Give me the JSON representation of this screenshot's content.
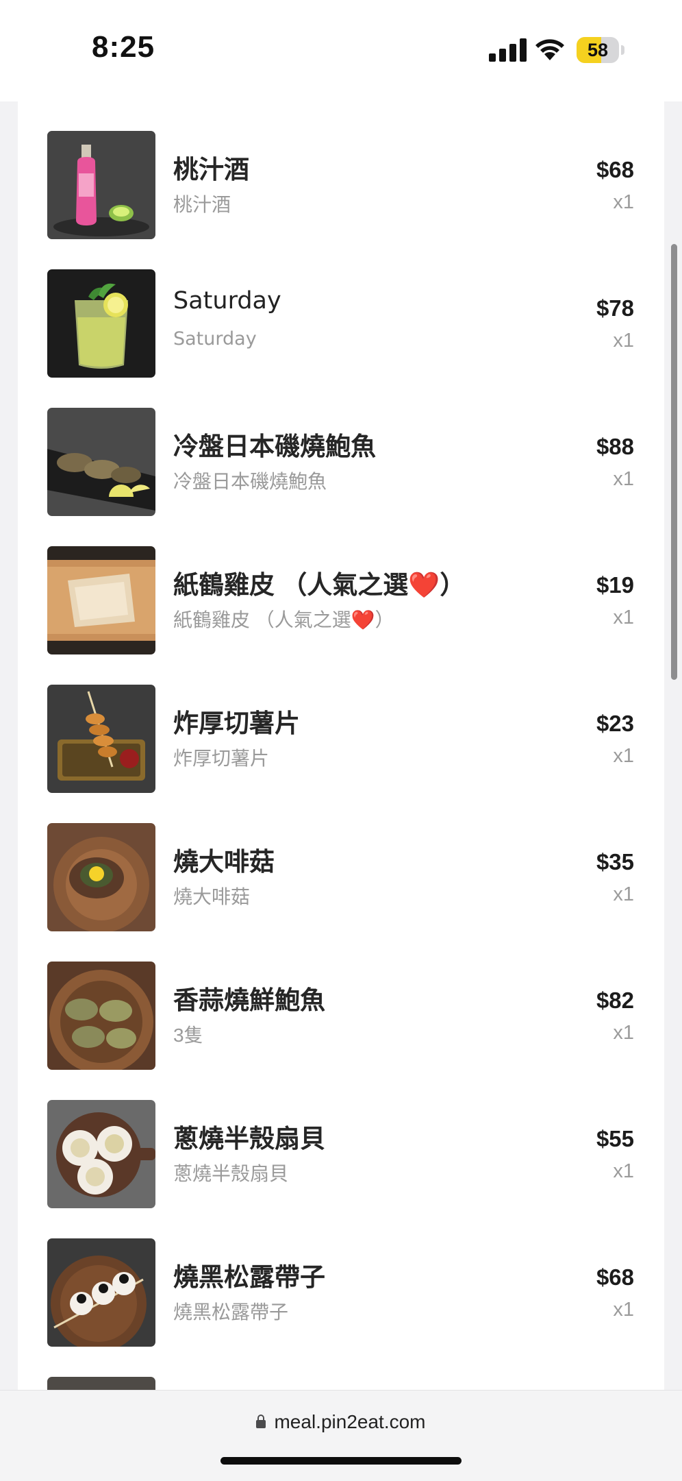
{
  "status_bar": {
    "time": "8:25",
    "battery": "58",
    "battery_level": 0.58,
    "accent_color": "#f5d11f"
  },
  "order_items": [
    {
      "name": "桃汁酒",
      "description": "桃汁酒",
      "price": "$68",
      "quantity": "x1",
      "image_icon": "peach-liquor-bottle"
    },
    {
      "name": "Saturday",
      "description": "Saturday",
      "price": "$78",
      "quantity": "x1",
      "image_icon": "mint-lime-cocktail"
    },
    {
      "name": "冷盤日本磯燒鮑魚",
      "description": "冷盤日本磯燒鮑魚",
      "price": "$88",
      "quantity": "x1",
      "image_icon": "cold-abalone-with-lemon"
    },
    {
      "name": "紙鶴雞皮 （人氣之選",
      "name_heart": "❤️",
      "name_close": "）",
      "description": "紙鶴雞皮 （人氣之選",
      "description_heart": "❤️",
      "description_close": "）",
      "price": "$19",
      "quantity": "x1",
      "image_icon": "crispy-chicken-skin"
    },
    {
      "name": "炸厚切薯片",
      "description": "炸厚切薯片",
      "price": "$23",
      "quantity": "x1",
      "image_icon": "spiral-potato-fries"
    },
    {
      "name": "燒大啡菇",
      "description": "燒大啡菇",
      "price": "$35",
      "quantity": "x1",
      "image_icon": "grilled-mushroom-egg"
    },
    {
      "name": "香蒜燒鮮鮑魚",
      "description": "3隻",
      "price": "$82",
      "quantity": "x1",
      "image_icon": "garlic-abalone"
    },
    {
      "name": "蔥燒半殼扇貝",
      "description": "蔥燒半殼扇貝",
      "price": "$55",
      "quantity": "x1",
      "image_icon": "scallop-half-shell"
    },
    {
      "name": "燒黑松露帶子",
      "description": "燒黑松露帶子",
      "price": "$68",
      "quantity": "x1",
      "image_icon": "truffle-scallop-skewer"
    }
  ],
  "browser": {
    "url": "meal.pin2eat.com"
  }
}
